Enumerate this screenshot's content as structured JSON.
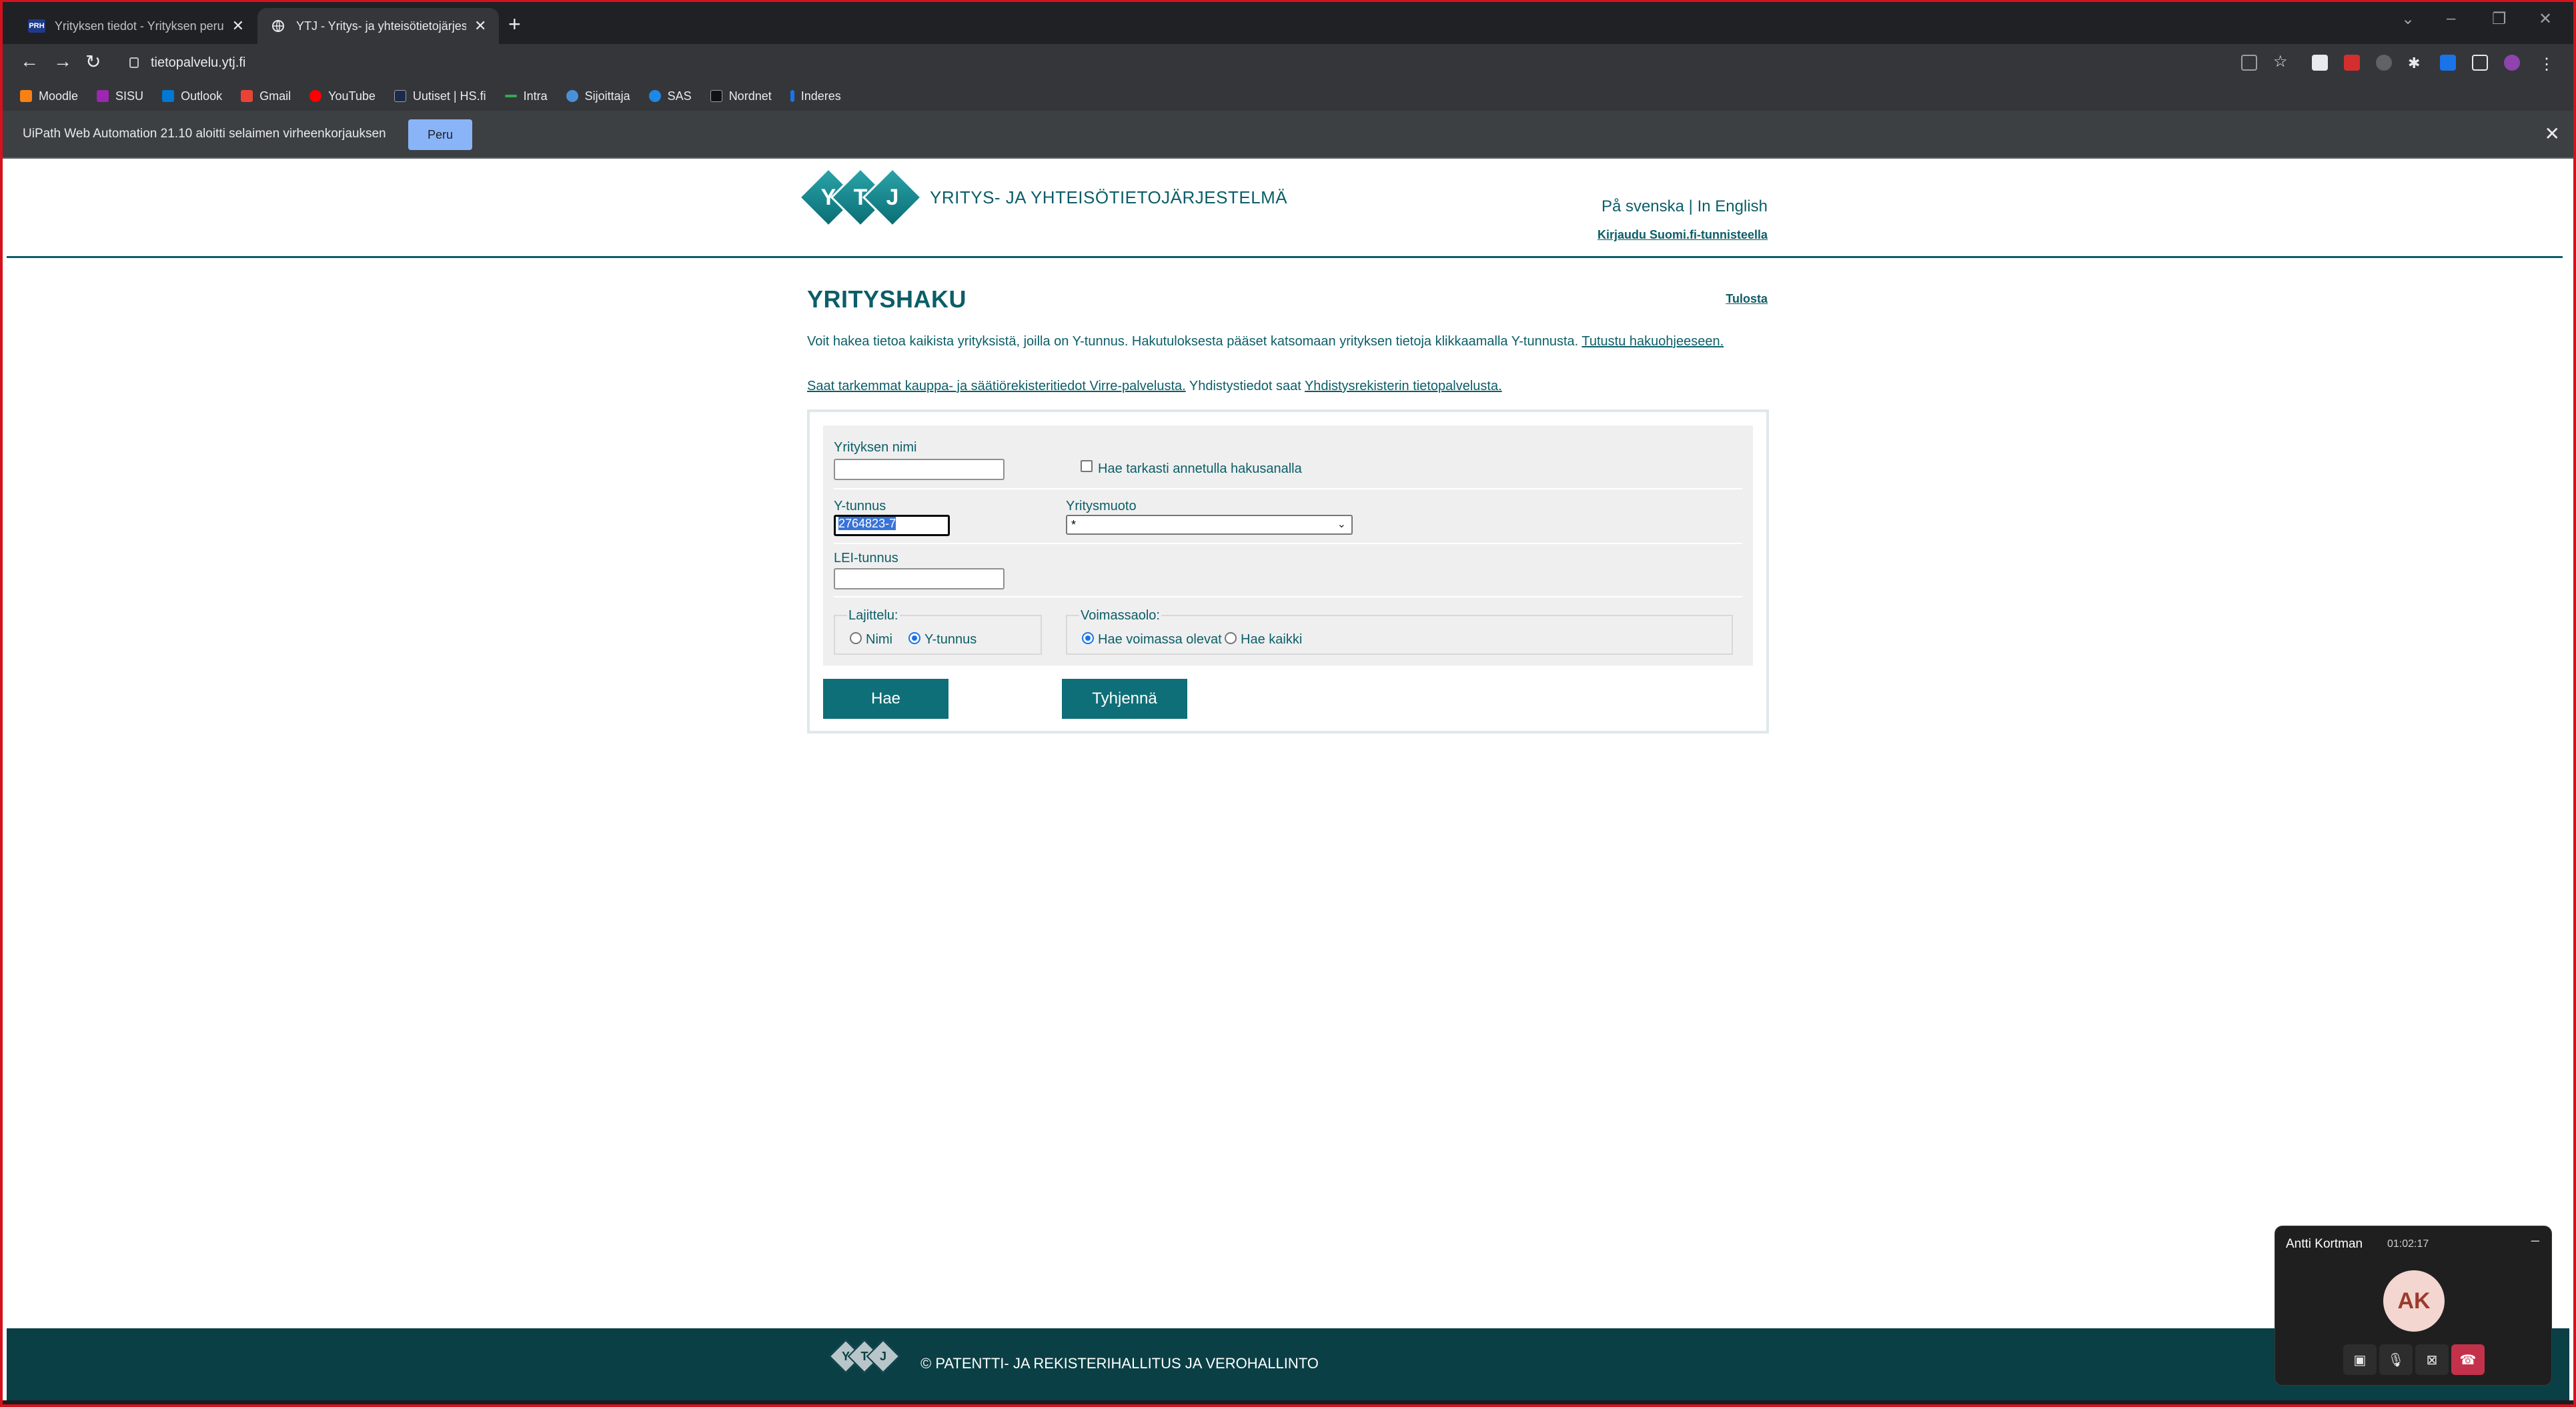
{
  "browser": {
    "tabs": [
      {
        "title": "Yrityksen tiedot - Yrityksen perus",
        "favicon": "PRH",
        "active": false
      },
      {
        "title": "YTJ - Yritys- ja yhteisötietojärjestelmä",
        "favicon": "globe-icon",
        "active": true
      }
    ],
    "new_tab": "+",
    "window_controls": [
      "⌄",
      "–",
      "❐",
      "✕"
    ],
    "url": "tietopalvelu.ytj.fi",
    "bookmarks": [
      {
        "label": "Moodle",
        "color": "#f98012"
      },
      {
        "label": "SISU",
        "color": "#9c27b0"
      },
      {
        "label": "Outlook",
        "color": "#0078d4"
      },
      {
        "label": "Gmail",
        "color": "#ea4335"
      },
      {
        "label": "YouTube",
        "color": "#ff0000"
      },
      {
        "label": "Uutiset | HS.fi",
        "color": "#1b2a4a"
      },
      {
        "label": "Intra",
        "color": "#34a853"
      },
      {
        "label": "Sijoittaja",
        "color": "#4a90d9"
      },
      {
        "label": "SAS",
        "color": "#1e88e5"
      },
      {
        "label": "Nordnet",
        "color": "#111111"
      },
      {
        "label": "Inderes",
        "color": "#1a73e8"
      }
    ],
    "infobar": {
      "message": "UiPath Web Automation 21.10 aloitti selaimen virheenkorjauksen",
      "button": "Peru",
      "close": "✕"
    }
  },
  "site": {
    "logo_letters": [
      "Y",
      "T",
      "J"
    ],
    "logo_text": "YRITYS- JA YHTEISÖTIETOJÄRJESTELMÄ",
    "lang_sv": "På svenska",
    "lang_sep": " | ",
    "lang_en": "In English",
    "login": "Kirjaudu Suomi.fi-tunnisteella",
    "heading": "YRITYSHAKU",
    "print": "Tulosta",
    "intro_text": "Voit hakea tietoa kaikista yrityksistä, joilla on Y-tunnus. Hakutuloksesta pääset katsomaan yrityksen tietoja klikkaamalla Y-tunnusta. ",
    "intro_link": "Tutustu hakuohjeeseen.",
    "virre_link": "Saat tarkemmat kauppa- ja säätiörekisteritiedot Virre-palvelusta.",
    "yhd_text": " Yhdistystiedot saat ",
    "yhd_link": "Yhdistysrekisterin tietopalvelusta."
  },
  "form": {
    "company_name_label": "Yrityksen nimi",
    "company_name_value": "",
    "exact_search_label": "Hae tarkasti annetulla hakusanalla",
    "exact_search_checked": false,
    "ytunnus_label": "Y-tunnus",
    "ytunnus_value": "2764823-7",
    "company_form_label": "Yritysmuoto",
    "company_form_value": "*",
    "lei_label": "LEI-tunnus",
    "lei_value": "",
    "sort_label": "Lajittelu:",
    "sort_options": [
      {
        "label": "Nimi",
        "checked": false
      },
      {
        "label": "Y-tunnus",
        "checked": true
      }
    ],
    "validity_label": "Voimassaolo:",
    "validity_options": [
      {
        "label": "Hae voimassa olevat",
        "checked": true
      },
      {
        "label": "Hae kaikki",
        "checked": false
      }
    ],
    "search_button": "Hae",
    "clear_button": "Tyhjennä"
  },
  "footer": {
    "text": "© PATENTTI- JA REKISTERIHALLITUS JA VEROHALLINTO"
  },
  "call": {
    "name": "Antti Kortman",
    "time": "01:02:17",
    "initials": "AK",
    "minimize": "–"
  },
  "colors": {
    "brand_teal": "#0b5e68",
    "button_teal": "#0f6f78",
    "footer": "#0a3f45",
    "frame_red": "#d4121e"
  }
}
